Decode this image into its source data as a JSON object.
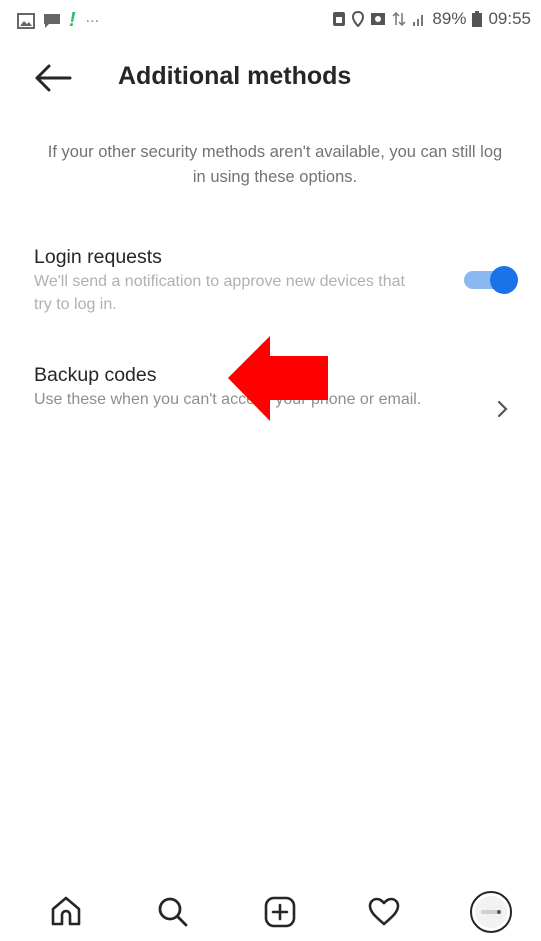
{
  "status_bar": {
    "battery": "89%",
    "time": "09:55",
    "dots": "..."
  },
  "header": {
    "title": "Additional methods"
  },
  "description": "If your other security methods aren't available, you can still log in using these options.",
  "login_requests": {
    "title": "Login requests",
    "subtitle": "We'll send a notification to approve new devices that try to log in.",
    "enabled": true
  },
  "backup_codes": {
    "title": "Backup codes",
    "subtitle": "Use these when you can't access your phone or email."
  },
  "colors": {
    "toggle_on": "#1a73e8",
    "toggle_track": "#8ab8f0",
    "annotation_arrow": "#ff0000"
  },
  "icons": {
    "back": "back-arrow-icon",
    "chevron": "chevron-right-icon",
    "nav": [
      "home-icon",
      "search-icon",
      "new-post-icon",
      "heart-icon",
      "profile-avatar-icon"
    ]
  }
}
